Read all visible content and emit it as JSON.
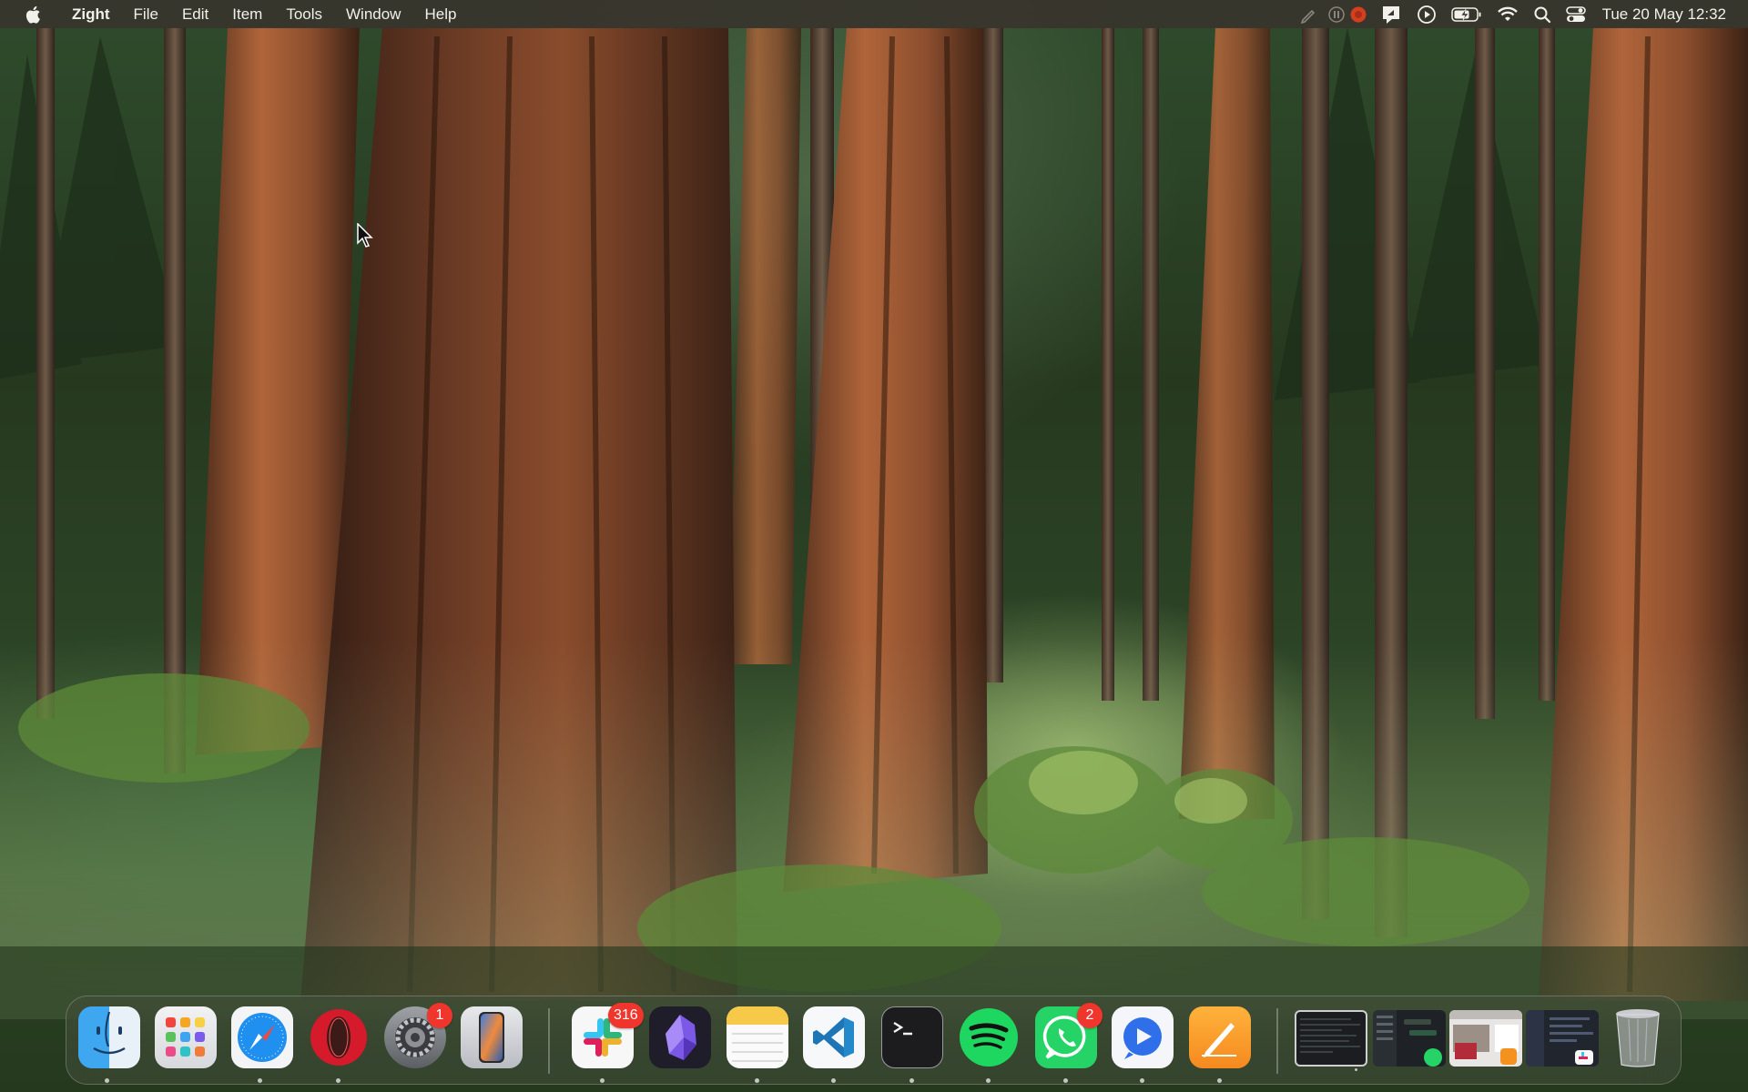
{
  "menubar": {
    "app_name": "Zight",
    "menus": [
      "File",
      "Edit",
      "Item",
      "Tools",
      "Window",
      "Help"
    ],
    "clock": "Tue 20 May  12:32",
    "status_icons": [
      "pen-icon",
      "pause-recording-icon",
      "stop-recording-icon",
      "zight-icon",
      "play-circle-icon",
      "battery-charging-icon",
      "wifi-icon",
      "search-icon",
      "control-center-icon"
    ]
  },
  "dock": {
    "apps": [
      {
        "name": "Finder",
        "icon": "finder-icon",
        "running": true
      },
      {
        "name": "Launchpad",
        "icon": "launchpad-icon",
        "running": false
      },
      {
        "name": "Safari",
        "icon": "safari-icon",
        "running": true
      },
      {
        "name": "Opera",
        "icon": "opera-icon",
        "running": true
      },
      {
        "name": "System Settings",
        "icon": "settings-icon",
        "running": false,
        "badge": "1"
      },
      {
        "name": "iPhone Mirroring",
        "icon": "iphone-mirroring-icon",
        "running": false
      },
      {
        "name": "Slack",
        "icon": "slack-icon",
        "running": true,
        "badge": "316"
      },
      {
        "name": "Obsidian",
        "icon": "obsidian-icon",
        "running": false
      },
      {
        "name": "Notes",
        "icon": "notes-icon",
        "running": true
      },
      {
        "name": "Visual Studio Code",
        "icon": "vscode-icon",
        "running": true
      },
      {
        "name": "Terminal",
        "icon": "terminal-icon",
        "running": true
      },
      {
        "name": "Spotify",
        "icon": "spotify-icon",
        "running": true
      },
      {
        "name": "WhatsApp",
        "icon": "whatsapp-icon",
        "running": true,
        "badge": "2"
      },
      {
        "name": "Zight",
        "icon": "zight-icon",
        "running": true
      },
      {
        "name": "Sketchbook",
        "icon": "pencil-icon",
        "running": true
      }
    ],
    "recent_windows": [
      "terminal-window",
      "whatsapp-window",
      "sketch-window",
      "slack-window"
    ],
    "trash": "trash-icon"
  },
  "colors": {
    "menubar_bg": "#38342c",
    "badge_red": "#f0352d",
    "dock_bg": "#464e3c"
  }
}
